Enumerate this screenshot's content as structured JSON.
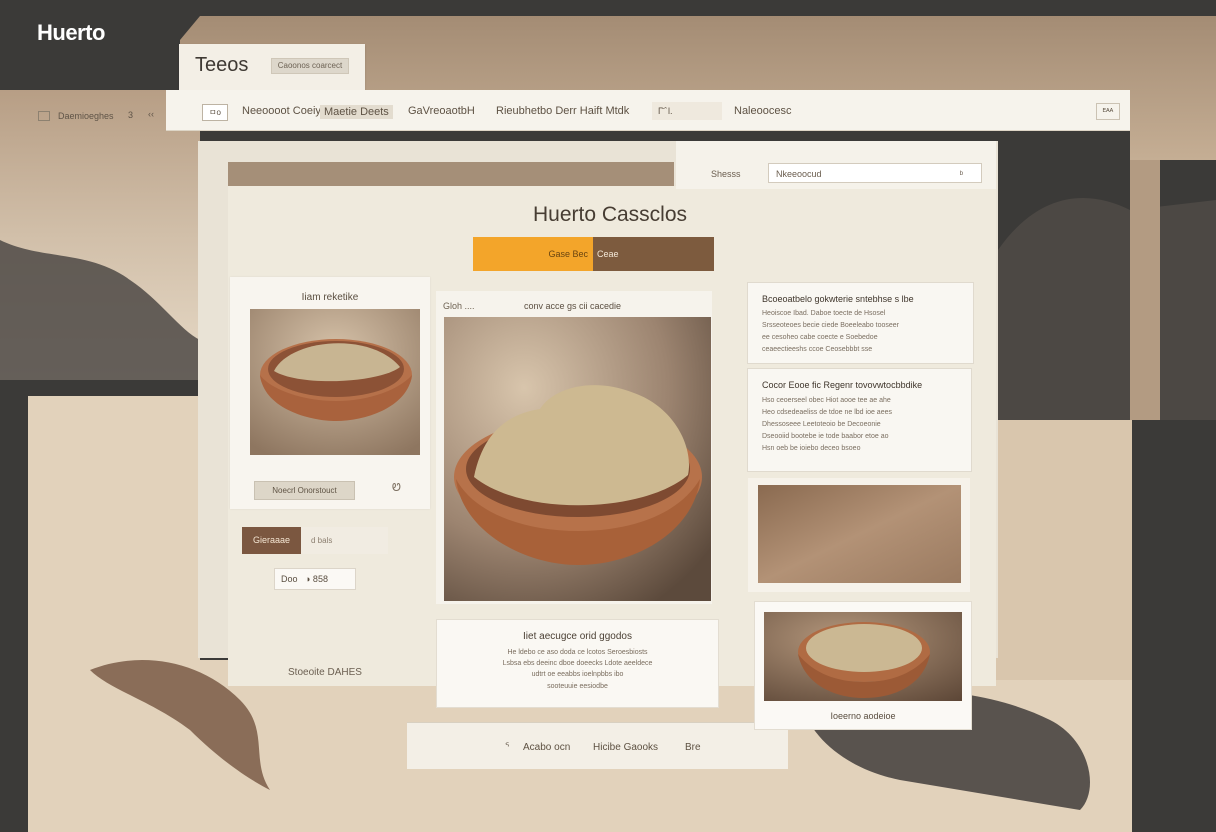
{
  "brand": "Huerto",
  "title_tab": {
    "title": "Teeos",
    "chip": "Caoonos coarcect"
  },
  "left_strip": {
    "label": "Daemioeghes",
    "number": "3",
    "chevron": "‹‹"
  },
  "topnav": {
    "logo_text": "ㅁo",
    "items": [
      "Neeoooot Coeiy",
      "Maetie Deets",
      "GaVreoaotbH",
      "Rieubhetbo Derr Haift Mtdk"
    ],
    "search_text": "Γ̄ ̂ l.",
    "right_label": "Naleoocesc",
    "right_button": "ᴱᴬᴬ"
  },
  "search_panel": {
    "label": "Shesss",
    "placeholder": "Nkeeoocud",
    "icon_glyph": "ᵇ"
  },
  "hero": {
    "title": "Huerto Cassclos",
    "btn_primary": "Gase Bec",
    "btn_secondary": "Ceae"
  },
  "left_card": {
    "heading": "Iiam reketike",
    "pill": "Noecrl Onorstouct",
    "tiny": "Ꮼ"
  },
  "brown_tabs": {
    "primary": "Gieraaae",
    "secondary": "d bals"
  },
  "qty": {
    "left": "Doo",
    "right": "◑ 858"
  },
  "left_footer": "Stoeoite DAHES",
  "center_card": {
    "top_left": "Gloh     ....",
    "top_right": "conv acce gs cii cacedie"
  },
  "desc_card": {
    "heading": "Iiet aecugce orid ggodos",
    "lines": [
      "He ldebo ce aso doda ce lcotos Seroesbiosts",
      "Lsbsa ebs deeinc dboe doeecks Ldote aeeldece",
      "udtrt oe eeabbs ioelnpbbs ibo",
      "sooteuuie eesiodbe"
    ]
  },
  "bottom_row": {
    "items": [
      "ᕐ",
      "Acabo ocn",
      "Hicibe Gaooks",
      "Bre"
    ]
  },
  "info1": {
    "heading": "Bcoeoatbelo gokwterie sntebhse s lbe",
    "lines": [
      "Heoiscoe Ibad. Daboe toecte de Hsosel",
      "Srsseoteoes becie ciede Boeeleabo tooseer",
      "ee cesoheo cabe coecte e Soebedoe",
      "ceaeectieeshs ccoe Ceosebbbt sse"
    ]
  },
  "info2": {
    "heading": "Cocor Eooe fic Regenr tovovwtocbbdike",
    "lines": [
      "Hso ceoerseel obec Hiot aooe tee ae ahe",
      "Heo cdsedeaeliss de tdoe ne lbd ioe aees",
      "Dhessoseee Leetoteoio be Decoeonie",
      "Dseooiid bootebe ie tode baabor etoe ao",
      "Hsn oeb be ioiebo deceo bsoeo"
    ]
  },
  "thumb_card": {
    "caption": "Ioeerno aodeioe"
  },
  "colors": {
    "accent_orange": "#f3a52a",
    "accent_brown": "#7d5b3e",
    "paper": "#efeadd",
    "dark": "#3b3a38"
  }
}
